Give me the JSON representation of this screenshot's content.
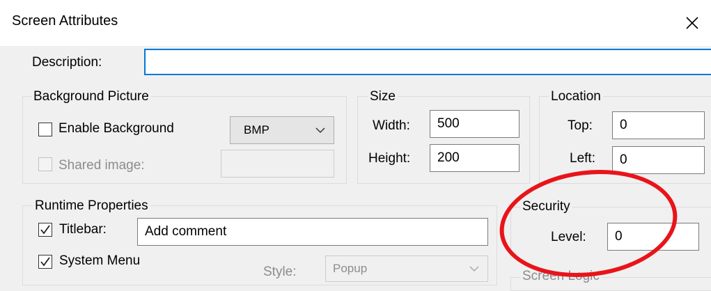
{
  "window": {
    "title": "Screen Attributes",
    "close_icon": "close-icon"
  },
  "description": {
    "label": "Description:",
    "value": ""
  },
  "background_picture": {
    "group_title": "Background Picture",
    "enable_label": "Enable Background",
    "enable_checked": false,
    "format_value": "BMP",
    "shared_label": "Shared image:",
    "shared_checked": false,
    "shared_value": ""
  },
  "size": {
    "group_title": "Size",
    "width_label": "Width:",
    "width_value": "500",
    "height_label": "Height:",
    "height_value": "200"
  },
  "location": {
    "group_title": "Location",
    "top_label": "Top:",
    "top_value": "0",
    "left_label": "Left:",
    "left_value": "0"
  },
  "runtime": {
    "group_title": "Runtime Properties",
    "titlebar_label": "Titlebar:",
    "titlebar_checked": true,
    "titlebar_value": "Add comment",
    "system_menu_label": "System Menu",
    "system_menu_checked": true,
    "style_label": "Style:",
    "style_value": "Popup"
  },
  "security": {
    "group_title": "Security",
    "level_label": "Level:",
    "level_value": "0"
  },
  "screen_logic": {
    "group_title": "Screen Logic"
  },
  "colors": {
    "accent": "#0078d7",
    "highlight_ellipse": "#e8141a",
    "background": "#f0f0f0"
  }
}
